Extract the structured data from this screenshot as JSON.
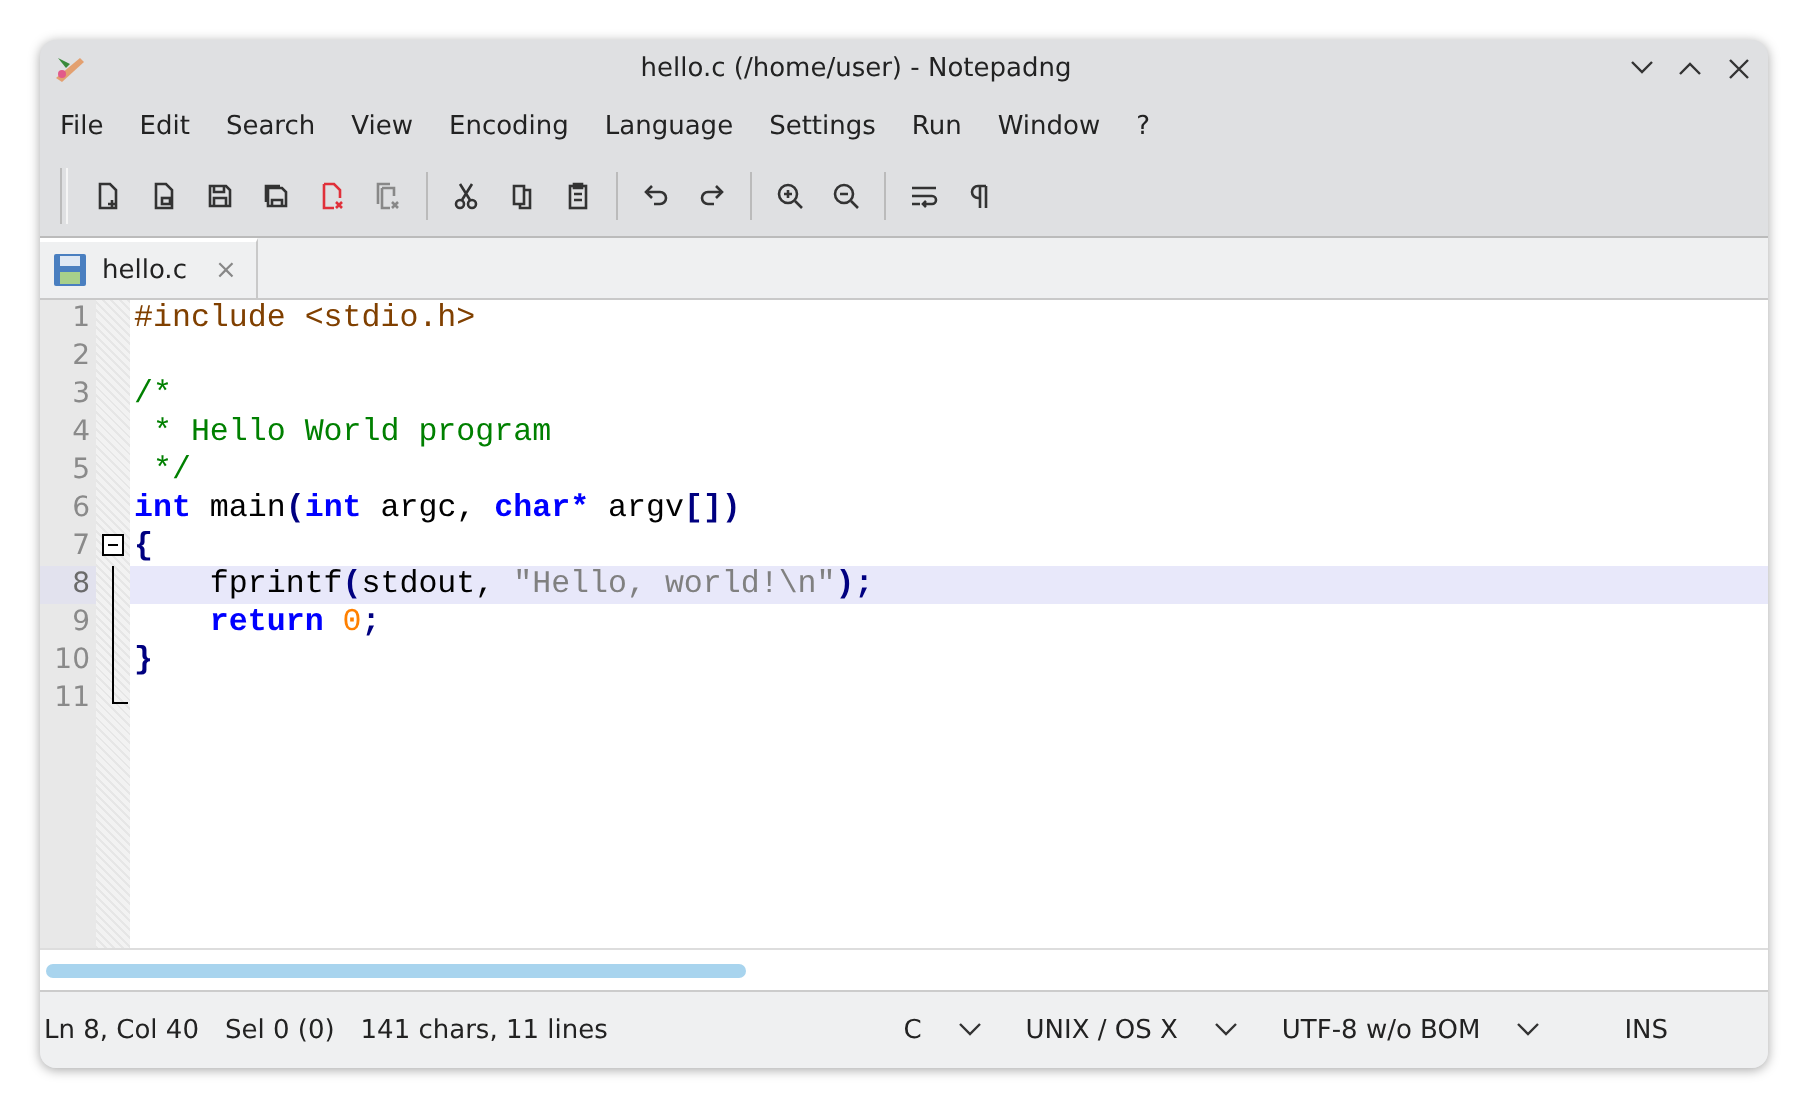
{
  "window": {
    "title": "hello.c (/home/user) - Notepadng"
  },
  "menu": [
    "File",
    "Edit",
    "Search",
    "View",
    "Encoding",
    "Language",
    "Settings",
    "Run",
    "Window",
    "?"
  ],
  "tabs": [
    {
      "label": "hello.c",
      "close": "×",
      "selected": true
    }
  ],
  "editor": {
    "lines": [
      {
        "number": "1",
        "kind": "plain",
        "current": false,
        "tokens": [
          {
            "kind": "pre",
            "text": "#include <stdio.h>"
          }
        ]
      },
      {
        "number": "2",
        "kind": "plain",
        "current": false
      },
      {
        "number": "3",
        "kind": "plain",
        "current": false,
        "tokens": [
          {
            "kind": "comment",
            "text": "/*"
          }
        ]
      },
      {
        "number": "4",
        "kind": "plain",
        "current": false,
        "tokens": [
          {
            "kind": "comment",
            "text": " * Hello World program"
          }
        ]
      },
      {
        "number": "5",
        "kind": "plain",
        "current": false,
        "tokens": [
          {
            "kind": "comment",
            "text": " */"
          }
        ]
      },
      {
        "number": "6",
        "kind": "plain",
        "current": false,
        "tokens": [
          {
            "kind": "keyword",
            "text": "int"
          },
          {
            "kind": "plain",
            "text": " main"
          },
          {
            "kind": "op",
            "text": "("
          },
          {
            "kind": "keyword",
            "text": "int"
          },
          {
            "kind": "plain",
            "text": " argc, "
          },
          {
            "kind": "keyword",
            "text": "char*"
          },
          {
            "kind": "plain",
            "text": " argv"
          },
          {
            "kind": "op",
            "text": "[])"
          }
        ]
      },
      {
        "number": "7",
        "kind": "foldstart",
        "current": false,
        "tokens": [
          {
            "kind": "op",
            "text": "{"
          }
        ]
      },
      {
        "number": "8",
        "kind": "folded",
        "current": true,
        "tokens": [
          {
            "kind": "plain",
            "text": "    fprintf"
          },
          {
            "kind": "op",
            "text": "("
          },
          {
            "kind": "plain",
            "text": "stdout, "
          },
          {
            "kind": "string",
            "text": "\"Hello, world!\\n\""
          },
          {
            "kind": "op",
            "text": ");"
          }
        ]
      },
      {
        "number": "9",
        "kind": "folded",
        "current": false,
        "tokens": [
          {
            "kind": "keyword",
            "text": "    return"
          },
          {
            "kind": "number",
            "text": " 0"
          },
          {
            "kind": "op",
            "text": ";"
          }
        ]
      },
      {
        "number": "10",
        "kind": "folded",
        "current": false,
        "tokens": [
          {
            "kind": "op",
            "text": "}"
          }
        ]
      },
      {
        "number": "11",
        "kind": "foldend",
        "current": false
      }
    ]
  },
  "status_bar": {
    "info": [
      "Ln 8, Col 40",
      "Sel 0 (0)",
      "141 chars, 11 lines"
    ],
    "dropdowns": [
      "C",
      "UNIX / OS X",
      "UTF-8 w/o BOM"
    ],
    "mode": "INS"
  }
}
